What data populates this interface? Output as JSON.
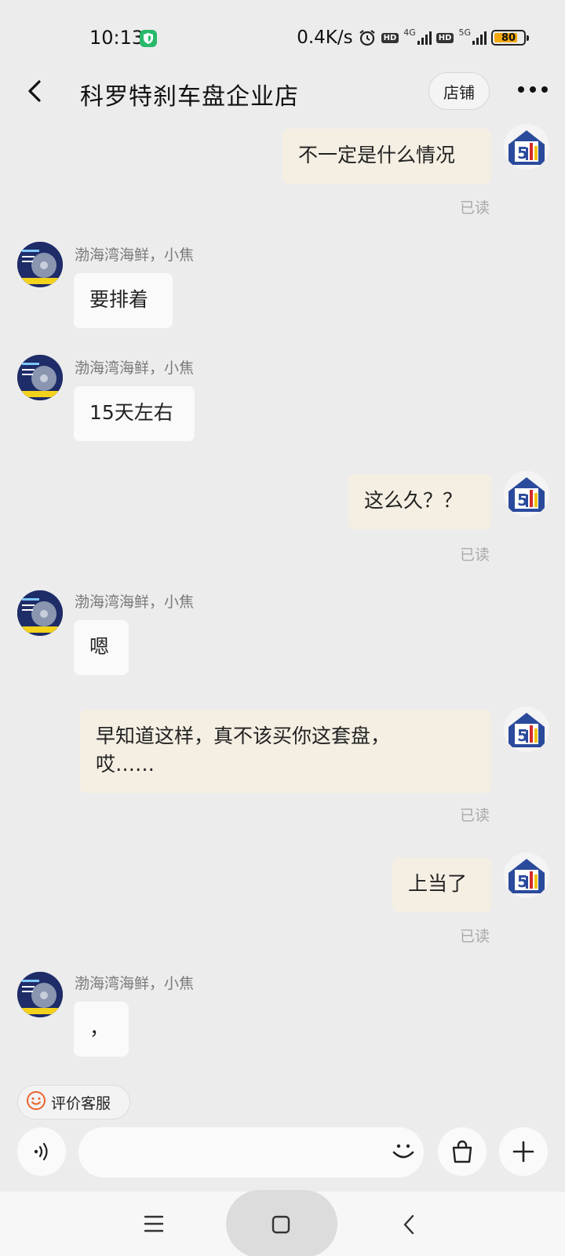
{
  "status_bar": {
    "time": "10:13",
    "net_speed": "0.4K/s",
    "hd1": "HD",
    "net1": "4G",
    "hd2": "HD",
    "net2": "5G",
    "battery": "80",
    "battery_level": 0.8
  },
  "header": {
    "title": "科罗特刹车盘企业店",
    "shop_label": "店铺"
  },
  "messages": [
    {
      "side": "self",
      "text": "不一定是什么情况",
      "read": "已读"
    },
    {
      "side": "other",
      "sender": "渤海湾海鲜，小焦",
      "text": "要排着"
    },
    {
      "side": "other",
      "sender": "渤海湾海鲜，小焦",
      "text": "15天左右"
    },
    {
      "side": "self",
      "text": "这么久？？",
      "read": "已读"
    },
    {
      "side": "other",
      "sender": "渤海湾海鲜，小焦",
      "text": "嗯"
    },
    {
      "side": "self",
      "text_line1": "早知道这样，真不该买你这套盘，",
      "text_line2": "哎……",
      "read": "已读"
    },
    {
      "side": "self",
      "text": "上当了",
      "read": "已读"
    },
    {
      "side": "other",
      "sender": "渤海湾海鲜，小焦",
      "text": "，"
    }
  ],
  "footer": {
    "rate_label": "评价客服",
    "input_placeholder": ""
  },
  "colors": {
    "background": "#ececec",
    "self_bubble": "#f5efe3",
    "other_bubble": "#fafafa",
    "rate_icon": "#e8632a"
  },
  "icons": [
    "back-icon",
    "more-icon",
    "voice-icon",
    "emoji-icon",
    "shopping-bag-icon",
    "plus-icon",
    "menu-icon",
    "home-icon",
    "nav-back-icon"
  ]
}
